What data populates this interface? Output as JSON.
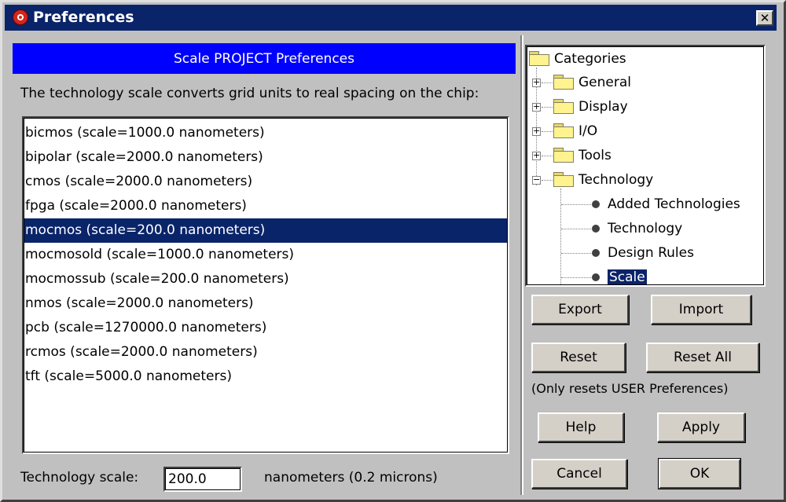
{
  "window": {
    "title": "Preferences",
    "close_label": "✕"
  },
  "left": {
    "header": "Scale PROJECT Preferences",
    "description": "The technology scale converts grid units to real spacing on the chip:",
    "items": [
      "bicmos (scale=1000.0 nanometers)",
      "bipolar (scale=2000.0 nanometers)",
      "cmos (scale=2000.0 nanometers)",
      "fpga (scale=2000.0 nanometers)",
      "mocmos (scale=200.0 nanometers)",
      "mocmosold (scale=1000.0 nanometers)",
      "mocmossub (scale=200.0 nanometers)",
      "nmos (scale=2000.0 nanometers)",
      "pcb (scale=1270000.0 nanometers)",
      "rcmos (scale=2000.0 nanometers)",
      "tft (scale=5000.0 nanometers)"
    ],
    "selected_index": 4,
    "scale_label": "Technology scale:",
    "scale_value": "200.0",
    "units_label": "nanometers (0.2 microns)"
  },
  "tree": {
    "root": "Categories",
    "folders": [
      "General",
      "Display",
      "I/O",
      "Tools",
      "Technology"
    ],
    "technology_children": [
      "Added Technologies",
      "Technology",
      "Design Rules",
      "Scale"
    ],
    "selected": "Scale"
  },
  "buttons": {
    "export": "Export",
    "import": "Import",
    "reset": "Reset",
    "reset_all": "Reset All",
    "note": "(Only resets USER Preferences)",
    "help": "Help",
    "apply": "Apply",
    "cancel": "Cancel",
    "ok": "OK"
  },
  "colors": {
    "titlebar": "#0a246a",
    "header": "#0000ff",
    "selection": "#0a246a",
    "face": "#c0c0c0"
  }
}
